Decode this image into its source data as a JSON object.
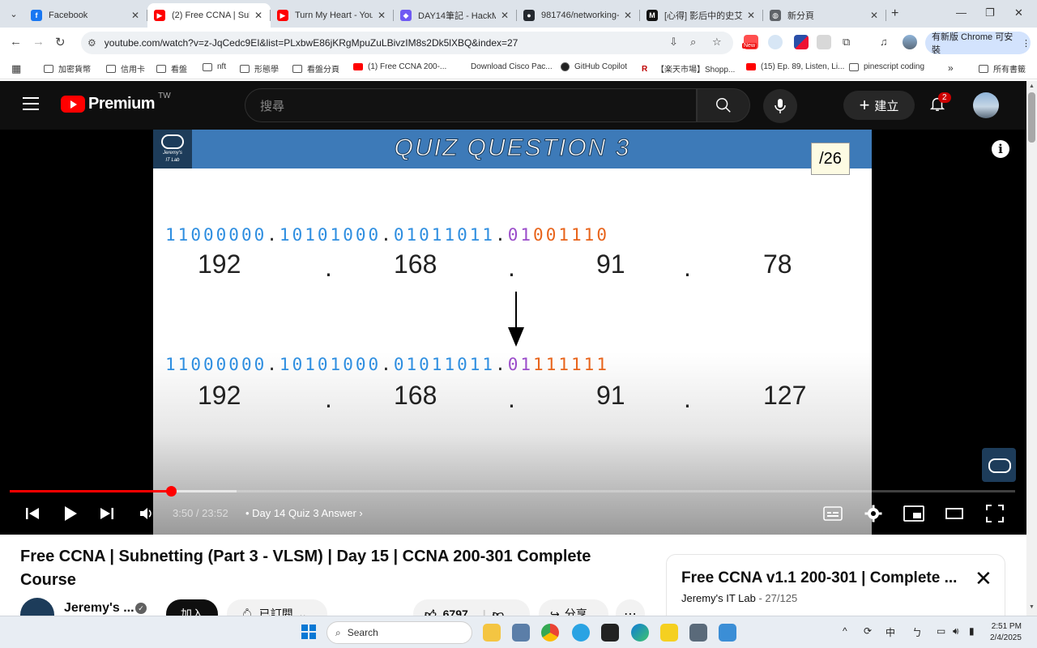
{
  "browser": {
    "tabs": [
      {
        "title": "Facebook",
        "color": "#1877f2",
        "glyph": "f"
      },
      {
        "title": "(2) Free CCNA | Subn",
        "color": "#ff0000",
        "glyph": "▶"
      },
      {
        "title": "Turn My Heart - YouT",
        "color": "#ff0000",
        "glyph": "▶"
      },
      {
        "title": "DAY14筆記 - HackM",
        "color": "#6f5af3",
        "glyph": "◆"
      },
      {
        "title": "981746/networking-",
        "color": "#24292f",
        "glyph": "●"
      },
      {
        "title": "[心得] 影后中的史艾",
        "color": "#111",
        "glyph": "M"
      },
      {
        "title": "新分頁",
        "color": "#5f6368",
        "glyph": "◍"
      }
    ],
    "active_tab": 1,
    "url": "youtube.com/watch?v=z-JqCedc9EI&list=PLxbwE86jKRgMpuZuLBivzIM8s2Dk5lXBQ&index=27",
    "update_label": "有新版 Chrome 可安裝",
    "new_badge": "New",
    "bookmarks": [
      {
        "label": "加密貨幣",
        "type": "folder"
      },
      {
        "label": "信用卡",
        "type": "folder"
      },
      {
        "label": "看盤",
        "type": "folder"
      },
      {
        "label": "nft",
        "type": "folder"
      },
      {
        "label": "形態學",
        "type": "folder"
      },
      {
        "label": "看盤分頁",
        "type": "folder"
      },
      {
        "label": "(1) Free CCNA 200-...",
        "type": "youtube"
      },
      {
        "label": "Download Cisco Pac...",
        "type": "page"
      },
      {
        "label": "GitHub Copilot",
        "type": "github"
      },
      {
        "label": "【楽天市場】Shopp...",
        "type": "rakuten"
      },
      {
        "label": "(15) Ep. 89, Listen, Li...",
        "type": "youtube"
      },
      {
        "label": "pinescript coding",
        "type": "folder"
      }
    ],
    "bookmarks_more": "»",
    "all_bookmarks": "所有書籤"
  },
  "youtube": {
    "brand": "Premium",
    "region": "TW",
    "search_placeholder": "搜尋",
    "create_label": "建立",
    "notification_count": "2"
  },
  "video": {
    "banner_title": "QUIZ QUESTION 3",
    "logo_text_1": "Jeremy's",
    "logo_text_2": "IT Lab",
    "counter": "/26",
    "rows": [
      {
        "binary": [
          "11000000",
          "10101000",
          "01011011",
          "01001110"
        ],
        "decimal": [
          "192",
          "168",
          "91",
          "78"
        ]
      },
      {
        "binary": [
          "11000000",
          "10101000",
          "01011011",
          "01111111"
        ],
        "decimal": [
          "192",
          "168",
          "91",
          "127"
        ]
      }
    ],
    "colors": {
      "network": "#2e8ee0",
      "subnet": "#9b4dca",
      "host": "#e8641b"
    },
    "time_current": "3:50",
    "time_total": "23:52",
    "chapter": "Day 14 Quiz 3 Answer",
    "progress_fraction": 0.16,
    "buffer_fraction": 0.226
  },
  "page": {
    "title": "Free CCNA | Subnetting (Part 3 - VLSM) | Day 15 | CCNA 200-301 Complete Course",
    "channel_name": "Jeremy's ...",
    "join_label": "加入",
    "subscribed_label": "已訂閱",
    "like_count": "6797",
    "share_label": "分享",
    "playlist_title": "Free CCNA v1.1 200-301 | Complete ...",
    "playlist_channel": "Jeremy's IT Lab",
    "playlist_position": "27/125"
  },
  "taskbar": {
    "search_label": "Search",
    "ime_label": "中",
    "time": "2:51 PM",
    "date": "2/4/2025"
  }
}
